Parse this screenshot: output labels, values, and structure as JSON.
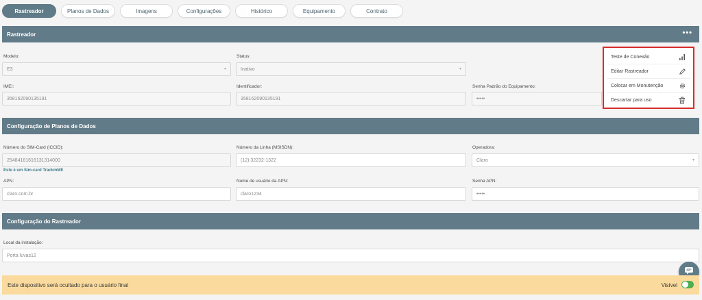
{
  "tabs": [
    {
      "label": "Rastreador",
      "active": true
    },
    {
      "label": "Planos de Dados"
    },
    {
      "label": "Imagens"
    },
    {
      "label": "Configurações"
    },
    {
      "label": "Histórico"
    },
    {
      "label": "Equipamento"
    },
    {
      "label": "Contrato"
    }
  ],
  "sections": {
    "tracker": "Rastreador",
    "data_plans": "Configuração de Planos de Dados",
    "tracker_config": "Configuração do Rastreador"
  },
  "more_icon": "•••",
  "tracker": {
    "model_label": "Modelo:",
    "model_value": "E3",
    "status_label": "Status:",
    "status_value": "Inativo",
    "imei_label": "IMEI:",
    "imei_value": "358162090135191",
    "id_label": "Identificador:",
    "id_value": "358162090135191",
    "password_label": "Senha Padrão do Equipamento:",
    "password_value": "•••••"
  },
  "data_plan": {
    "iccid_label": "Número do SIM-Card (ICCID):",
    "iccid_value": "25484161616131314000",
    "msisdn_label": "Número da Linha (MSISDN):",
    "msisdn_value": "(12) 32232-1322",
    "operator_label": "Operadora:",
    "operator_value": "Claro",
    "sim_hint": "Este é um Sim-card TrackmME",
    "apn_label": "APN:",
    "apn_value": "claro.com.br",
    "apn_user_label": "Nome de usuário da APN:",
    "apn_user_value": "claro1234",
    "apn_pass_label": "Senha APN:",
    "apn_pass_value": "•••••"
  },
  "tracker_config": {
    "location_label": "Local da instalação:",
    "location_value": "Porta luvas12"
  },
  "menu": [
    {
      "label": "Teste de Conexão",
      "icon": "signal-bars-icon"
    },
    {
      "label": "Editar Rastreador",
      "icon": "pencil-icon"
    },
    {
      "label": "Colocar em Monutenção",
      "icon": "gear-icon"
    },
    {
      "label": "Descartar para uso",
      "icon": "trash-icon"
    }
  ],
  "banner": {
    "text": "Este dispositivo será ocultado para o usuário final",
    "visible_label": "Visível",
    "visible_on": true
  },
  "colors": {
    "accent": "#627b88",
    "banner": "#fbdb9d",
    "highlight": "#d62b2b",
    "toggle": "#4caf50"
  }
}
